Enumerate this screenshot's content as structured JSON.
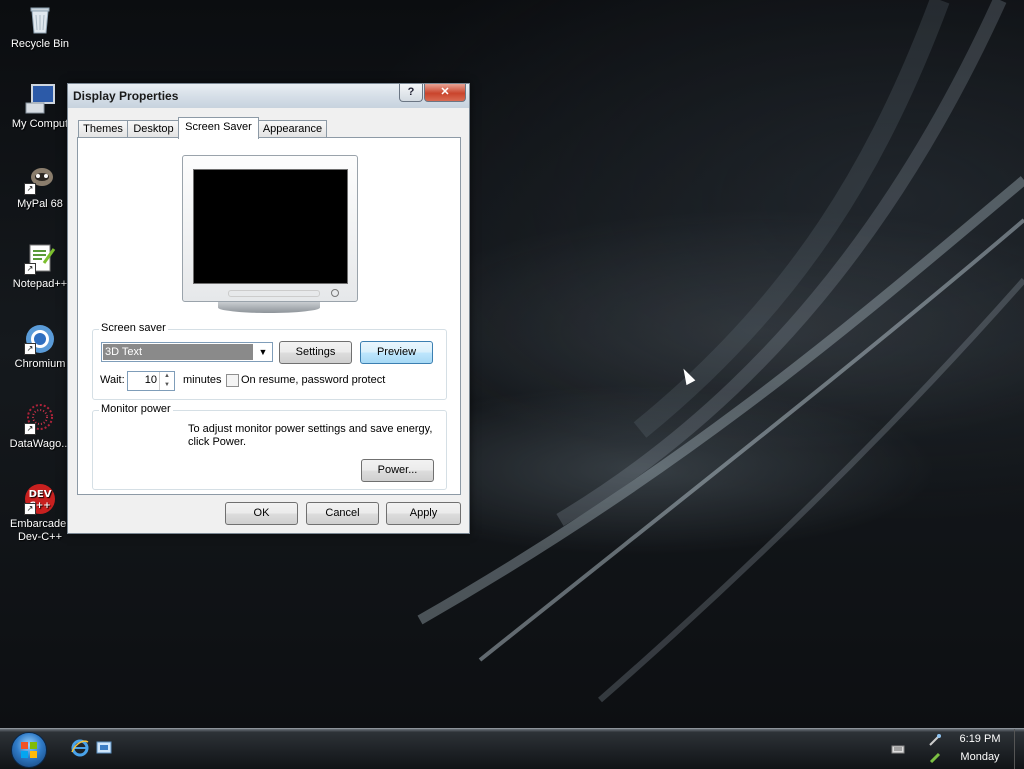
{
  "desktop": {
    "icons": [
      {
        "label": "Recycle Bin"
      },
      {
        "label": "My Comput"
      },
      {
        "label": "MyPal 68"
      },
      {
        "label": "Notepad++"
      },
      {
        "label": "Chromium"
      },
      {
        "label": "DataWago..."
      },
      {
        "label": "Embarcader\nDev-C++"
      }
    ]
  },
  "dialog": {
    "title": "Display Properties",
    "help_label": "?",
    "close_label": "✕",
    "tabs": [
      {
        "label": "Themes"
      },
      {
        "label": "Desktop"
      },
      {
        "label": "Screen Saver"
      },
      {
        "label": "Appearance"
      }
    ],
    "active_tab": "Screen Saver",
    "screen_saver": {
      "group_label": "Screen saver",
      "selected": "3D Text",
      "settings_label": "Settings",
      "preview_label": "Preview",
      "wait_label": "Wait:",
      "wait_value": "10",
      "minutes_label": "minutes",
      "password_protect_label": "On resume, password protect",
      "password_protect_checked": false
    },
    "monitor_power": {
      "group_label": "Monitor power",
      "description": "To adjust monitor power settings and save energy, click Power.",
      "power_label": "Power..."
    },
    "ok_label": "OK",
    "cancel_label": "Cancel",
    "apply_label": "Apply"
  },
  "taskbar": {
    "clock_time": "6:19 PM",
    "clock_day": "Monday"
  },
  "colors": {
    "close_red": "#c9442c",
    "default_button_blue": "#3c7fb1",
    "taskbar": "#1c2024"
  }
}
